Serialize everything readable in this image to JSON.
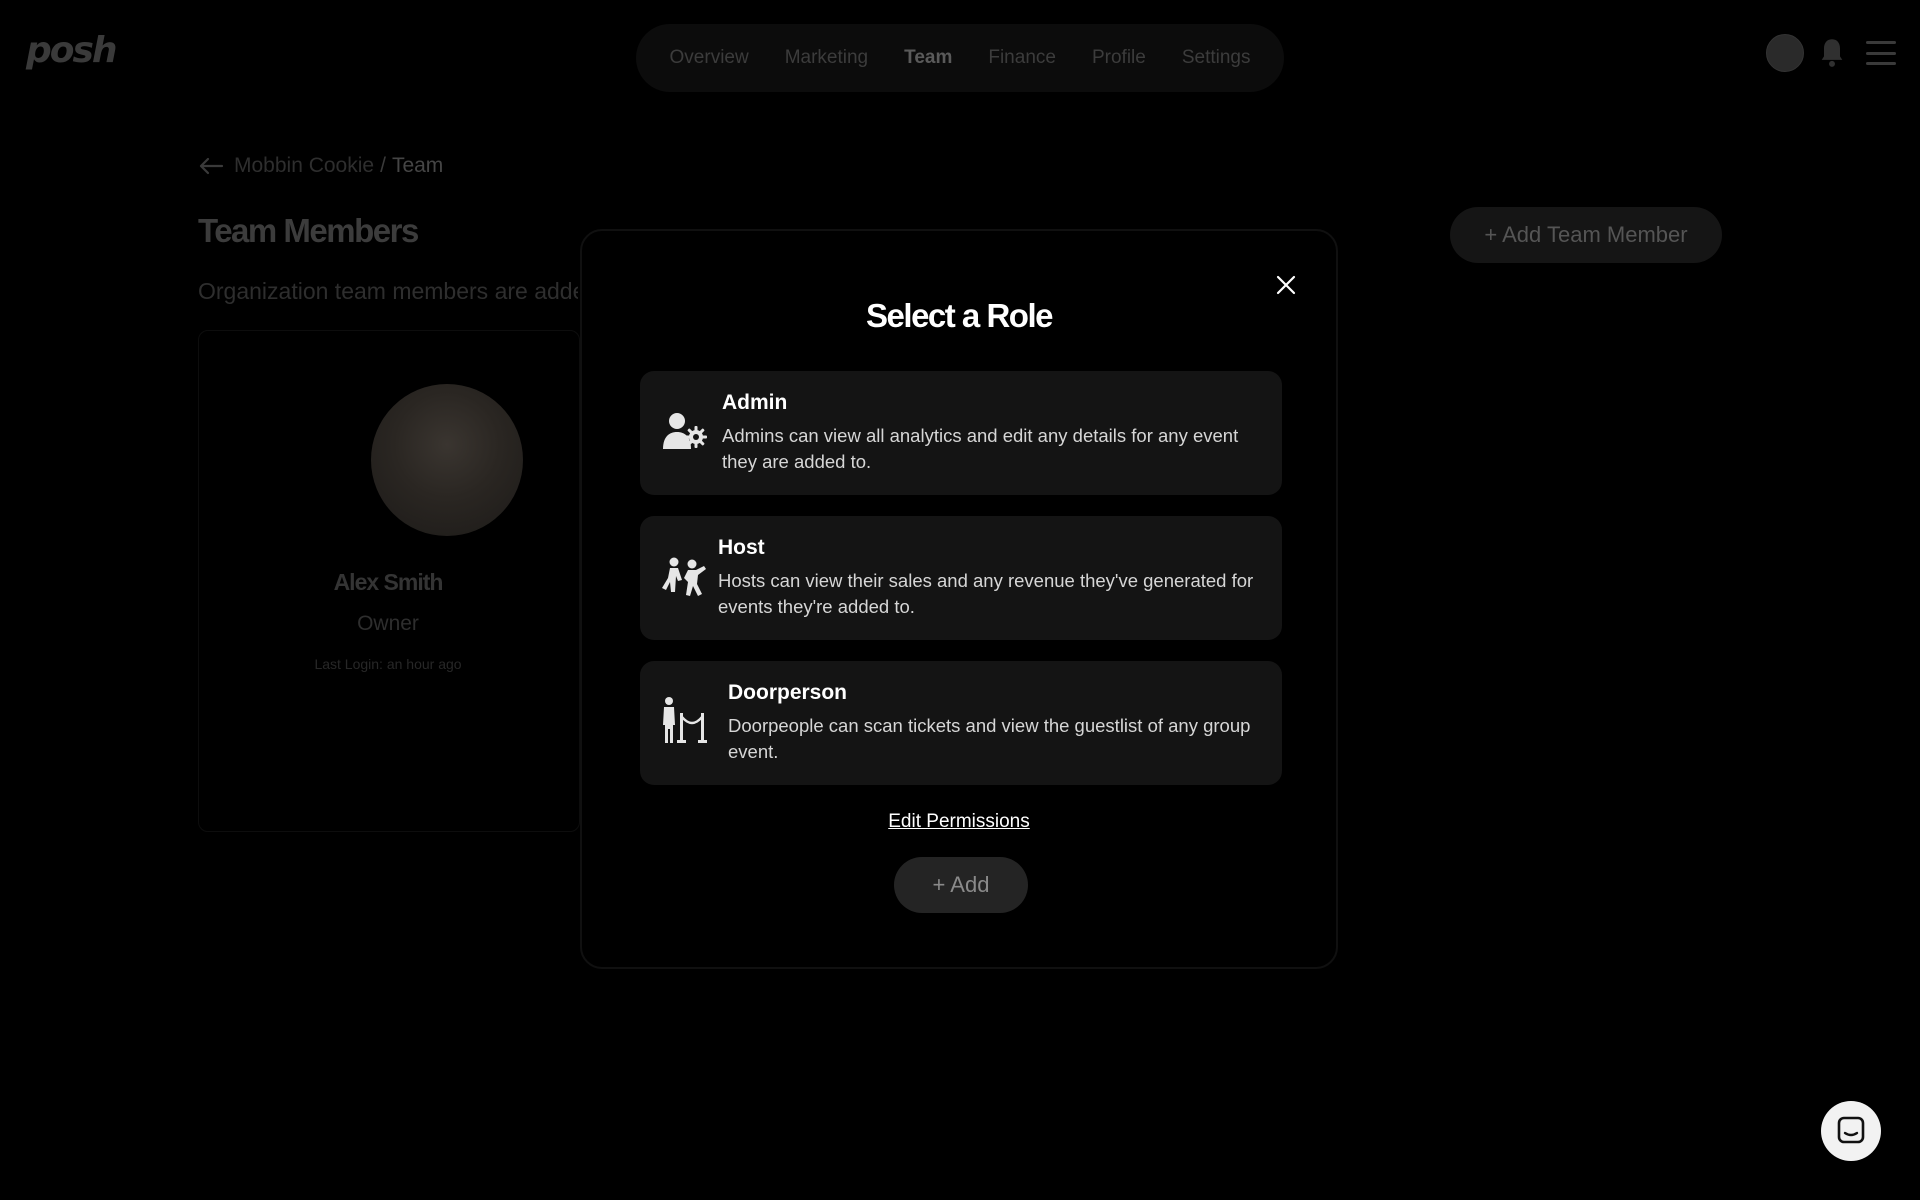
{
  "brand": {
    "logo_text": "posh"
  },
  "nav": {
    "items": [
      {
        "label": "Overview",
        "active": false
      },
      {
        "label": "Marketing",
        "active": false
      },
      {
        "label": "Team",
        "active": true
      },
      {
        "label": "Finance",
        "active": false
      },
      {
        "label": "Profile",
        "active": false
      },
      {
        "label": "Settings",
        "active": false
      }
    ]
  },
  "breadcrumb": {
    "parent": "Mobbin Cookie",
    "separator": "/",
    "current": "Team"
  },
  "page": {
    "title": "Team Members",
    "description": "Organization team members are added to",
    "add_member_label": "+ Add Team Member"
  },
  "member": {
    "name": "Alex Smith",
    "role": "Owner",
    "last_login": "Last Login: an hour ago"
  },
  "modal": {
    "title": "Select a Role",
    "roles": [
      {
        "name": "Admin",
        "description": "Admins can view all analytics and edit any details for any event they are added to.",
        "icon": "admin-icon"
      },
      {
        "name": "Host",
        "description": "Hosts can view their sales and any revenue they've generated for events they're added to.",
        "icon": "host-icon"
      },
      {
        "name": "Doorperson",
        "description": "Doorpeople can scan tickets and view the guestlist of any group event.",
        "icon": "doorperson-icon"
      }
    ],
    "edit_permissions_label": "Edit Permissions",
    "add_label": "+ Add"
  },
  "colors": {
    "background": "#000000",
    "card": "#141414",
    "text": "#ffffff",
    "muted": "#3a3a3a"
  }
}
